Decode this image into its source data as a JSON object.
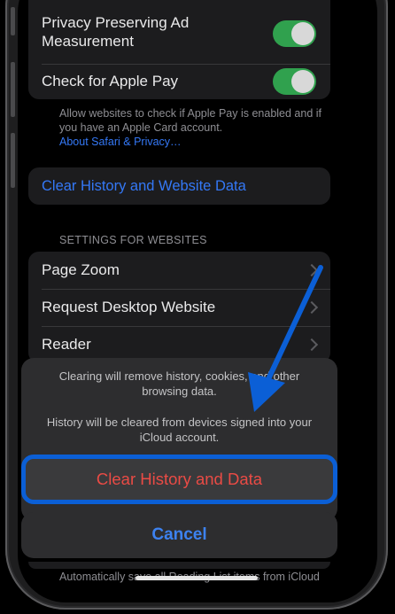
{
  "privacy_group": {
    "row1_label": "Privacy Preserving Ad Measurement",
    "row2_label": "Check for Apple Pay"
  },
  "apple_pay_footnote": {
    "text": "Allow websites to check if Apple Pay is enabled and if you have an Apple Card account.",
    "link": "About Safari & Privacy…"
  },
  "clear_history_row": {
    "label": "Clear History and Website Data"
  },
  "settings_for_websites": {
    "header": "SETTINGS FOR WEBSITES",
    "items": [
      {
        "label": "Page Zoom"
      },
      {
        "label": "Request Desktop Website"
      },
      {
        "label": "Reader"
      }
    ]
  },
  "action_sheet": {
    "message_line1": "Clearing will remove history, cookies, and other browsing data.",
    "message_line2": "History will be cleared from devices signed into your iCloud account.",
    "confirm_label": "Clear History and Data",
    "cancel_label": "Cancel"
  },
  "bottom_footnote": {
    "text": "Automatically save all Reading List items from iCloud"
  },
  "colors": {
    "toggle_on": "#30a14e",
    "link_blue": "#3478f6",
    "destructive_red": "#ea4b45",
    "annotation_blue": "#0b5fd6"
  },
  "icons": {
    "annotation": "arrow-icon",
    "disclosure": "chevron-right-icon"
  }
}
